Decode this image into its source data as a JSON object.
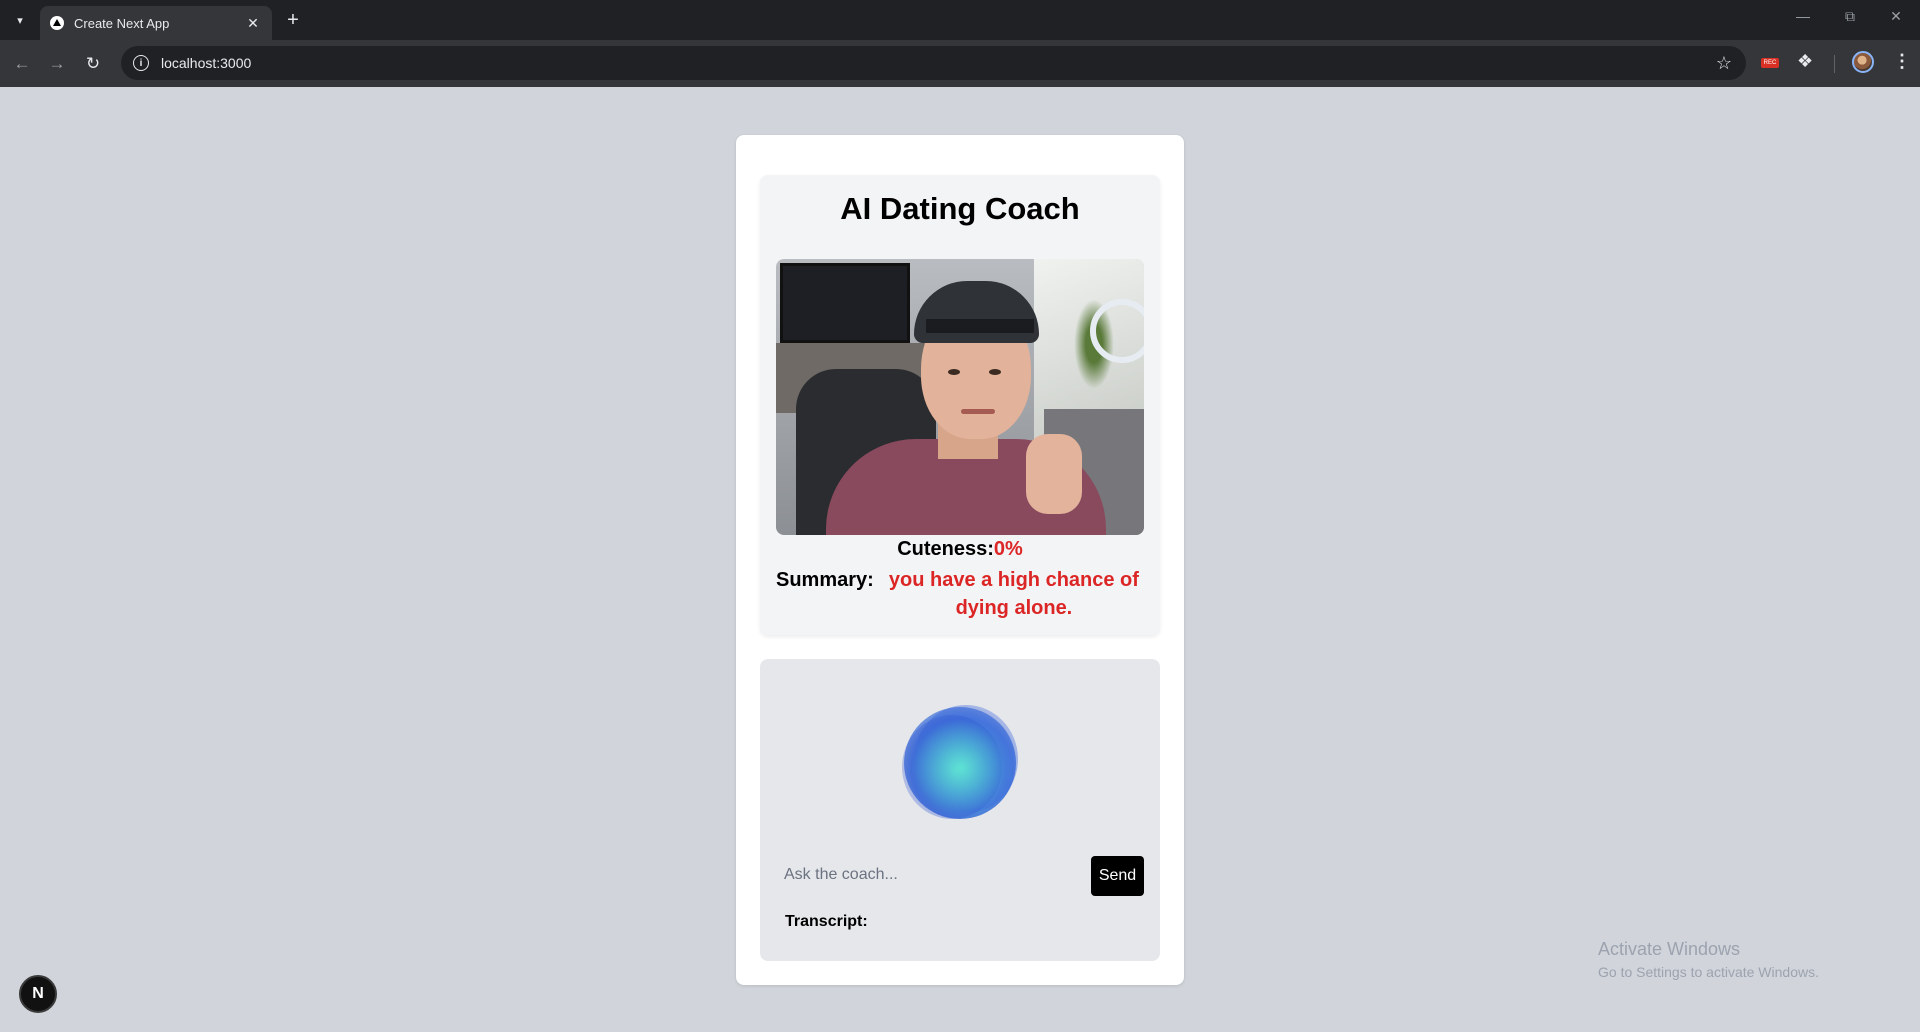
{
  "browser": {
    "tab_title": "Create Next App",
    "url": "localhost:3000",
    "extension_badge": "REC"
  },
  "app": {
    "title": "AI Dating Coach",
    "cuteness_label": "Cuteness:",
    "cuteness_value": "0%",
    "summary_label": "Summary:",
    "summary_value": "you have a high chance of dying alone.",
    "input_placeholder": "Ask the coach...",
    "send_label": "Send",
    "transcript_label": "Transcript:"
  },
  "dev_badge": "N",
  "os_watermark": {
    "title": "Activate Windows",
    "subtitle": "Go to Settings to activate Windows."
  },
  "colors": {
    "page_bg": "#d1d5db",
    "accent_red": "#dc2626",
    "button_bg": "#000000"
  }
}
